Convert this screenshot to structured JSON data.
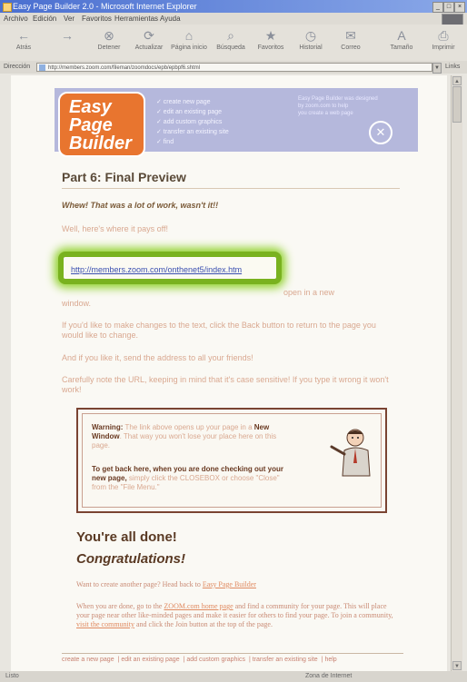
{
  "window": {
    "title": "Easy Page Builder 2.0 - Microsoft Internet Explorer"
  },
  "menu": [
    "Archivo",
    "Edición",
    "Ver",
    "Favoritos",
    "Herramientas",
    "Ayuda"
  ],
  "toolbar": [
    {
      "label": "Atrás",
      "icon": "back-arrow-icon"
    },
    {
      "label": "",
      "icon": "forward-arrow-icon"
    },
    {
      "label": "Detener",
      "icon": "stop-icon"
    },
    {
      "label": "Actualizar",
      "icon": "refresh-icon"
    },
    {
      "label": "Página inicio",
      "icon": "home-icon"
    },
    {
      "label": "Búsqueda",
      "icon": "search-icon"
    },
    {
      "label": "Favoritos",
      "icon": "favorites-icon"
    },
    {
      "label": "Historial",
      "icon": "history-icon"
    },
    {
      "label": "Correo",
      "icon": "mail-icon"
    },
    {
      "label": "Tamaño",
      "icon": "font-size-icon"
    },
    {
      "label": "Imprimir",
      "icon": "print-icon"
    }
  ],
  "address": {
    "label": "Dirección",
    "url": "http://members.zoom.com/fileman/zoomdocs/epb/epbpf6.shtml",
    "links_label": "Links"
  },
  "banner": {
    "logo_lines": [
      "Easy",
      "Page",
      "Builder"
    ],
    "checklist": [
      "✓ create new page",
      "✓ edit an existing page",
      "✓ add custom graphics",
      "✓ transfer an existing site",
      "✓ find"
    ],
    "side_text": [
      "Easy Page Builder was designed",
      "by zoom.com to help",
      "you create a web page"
    ]
  },
  "content": {
    "heading": "Part 6: Final Preview",
    "intro": "Whew! That was a lot of work, wasn't it!!",
    "payoff": "Well, here's where it pays off!",
    "url_link": "http://members.zoom.com/onthenet5/index.htm",
    "new_window_prefix": "",
    "new_window_suffix": " open in a new",
    "window_word": "window.",
    "changes": "If you'd like to make changes to the text, click the Back button to return to the page you would like to change.",
    "like_it": "And if you like it, send the address to all your friends!",
    "case_note": "Carefully note the URL, keeping in mind that it's case sensitive! If you type it wrong it won't work!"
  },
  "warning": {
    "label": "Warning:",
    "text_a": " The link above opens up your page in a ",
    "new_window_bold": "New Window",
    "text_b": ". That way you won't lose your place here on this page.",
    "get_back_bold": "To get back here, when you are done checking out your new page,",
    "text_c": " simply click the CLOSEBOX or choose \"Close\" from the \"File Menu.\""
  },
  "done": {
    "all_done": "You're all done!",
    "congrats": "Congratulations!",
    "create_prefix": "Want to create another page? Head back to ",
    "create_link": "Easy Page Builder",
    "when_done_a": "When you are done, go to the ",
    "zoom_link": "ZOOM.com home page",
    "when_done_b": " and find a community for your page. This will place your page near other like-minded pages and make it easier for others to find your page. To join a community, ",
    "visit_link": "visit the community",
    "when_done_c": " and click the Join button at the top of the page."
  },
  "footer_links": [
    "create a new page",
    "edit an existing page",
    "add custom graphics",
    "transfer an existing site",
    "help"
  ],
  "status": {
    "left": "Listo",
    "right": "Zona de Internet"
  }
}
